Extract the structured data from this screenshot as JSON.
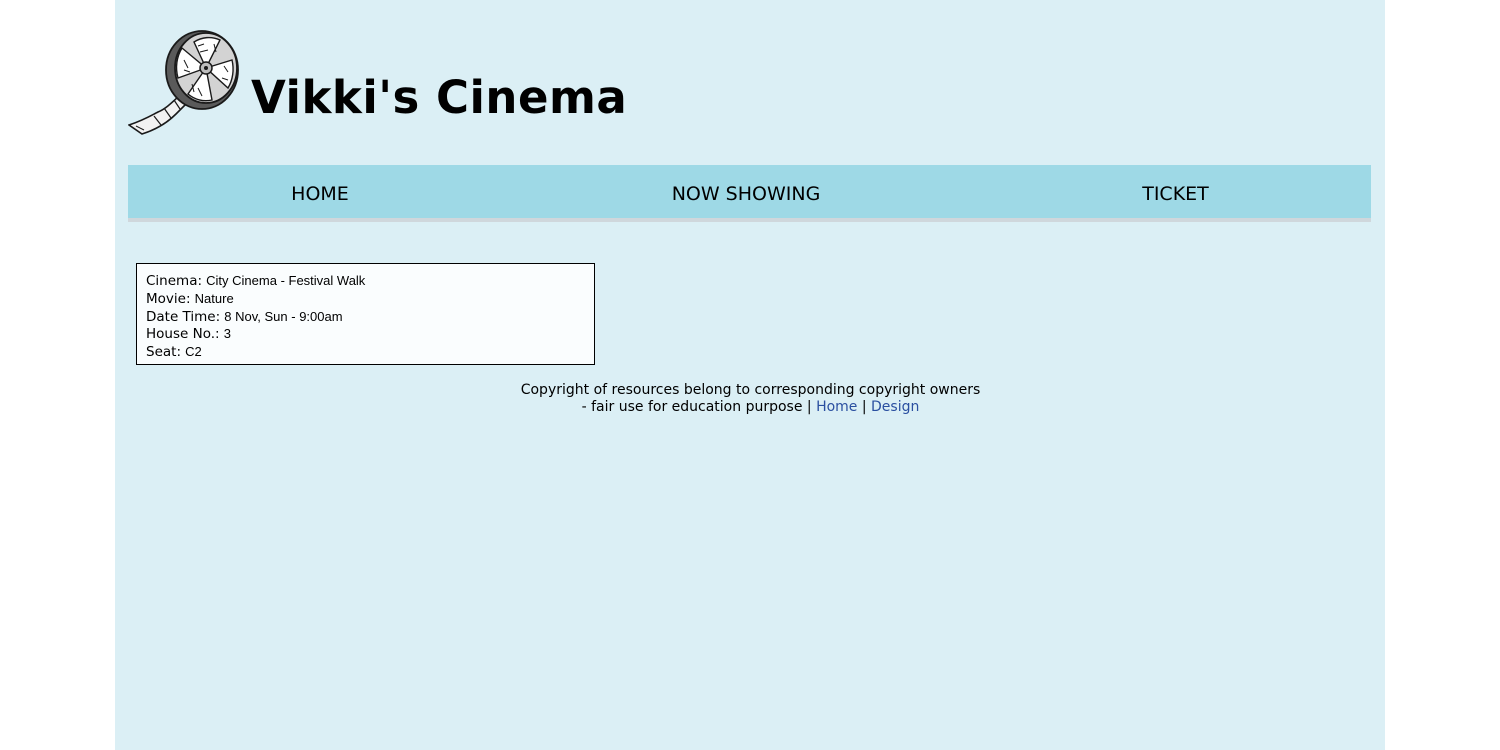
{
  "site": {
    "title": "Vikki's Cinema",
    "logo_icon": "film-reel-icon"
  },
  "nav": {
    "items": [
      {
        "label": "HOME"
      },
      {
        "label": "NOW SHOWING"
      },
      {
        "label": "TICKET"
      }
    ]
  },
  "ticket": {
    "cinema_label": "Cinema:",
    "cinema_value": "City Cinema - Festival Walk",
    "movie_label": "Movie:",
    "movie_value": "Nature",
    "datetime_label": "Date Time:",
    "datetime_value": "8 Nov, Sun - 9:00am",
    "house_label": "House No.:",
    "house_value": "3",
    "seat_label": "Seat:",
    "seat_value": "C2"
  },
  "footer": {
    "line1": "Copyright of resources belong to corresponding copyright owners",
    "line2_prefix": "- fair use for education purpose |",
    "home_link": "Home",
    "separator": "|",
    "design_link": "Design"
  },
  "colors": {
    "page_bg": "#dbeff5",
    "nav_bg": "#9ed9e6",
    "link": "#2a4fa0"
  }
}
